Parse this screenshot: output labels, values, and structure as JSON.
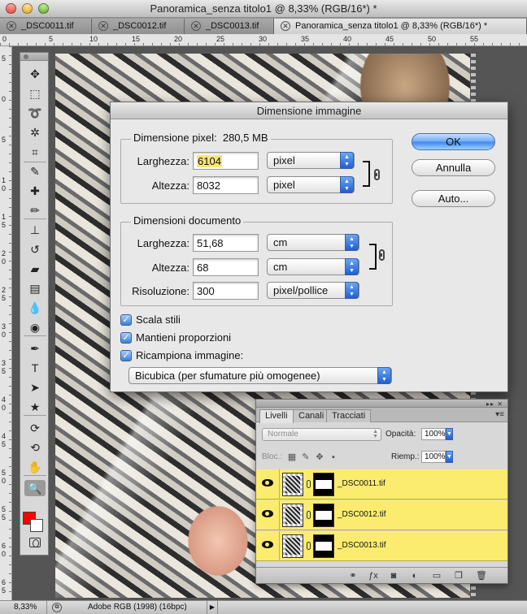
{
  "window": {
    "title": "Panoramica_senza titolo1 @ 8,33% (RGB/16*) *"
  },
  "tabs": [
    {
      "label": "_DSC0011.tif",
      "close_glyph": "✕"
    },
    {
      "label": "_DSC0012.tif",
      "close_glyph": "✕"
    },
    {
      "label": "_DSC0013.tif",
      "close_glyph": "✕"
    },
    {
      "label": "Panoramica_senza titolo1 @ 8,33% (RGB/16*) *",
      "close_glyph": "✕"
    }
  ],
  "ruler_top": [
    "0",
    "5",
    "10",
    "15",
    "20",
    "25",
    "30",
    "35",
    "40",
    "45",
    "50",
    "55"
  ],
  "ruler_left": [
    "5",
    "0",
    "5",
    "1 0",
    "1 5",
    "2 0",
    "2 5",
    "3 0",
    "3 5",
    "4 0",
    "4 5",
    "5 0",
    "5 5",
    "6 0",
    "6 5"
  ],
  "tools": [
    {
      "name": "move-tool-icon",
      "glyph": "✥"
    },
    {
      "name": "marquee-tool-icon",
      "glyph": "⬚"
    },
    {
      "name": "lasso-tool-icon",
      "glyph": "➰"
    },
    {
      "name": "magic-wand-tool-icon",
      "glyph": "✲"
    },
    {
      "name": "crop-tool-icon",
      "glyph": "⌗"
    },
    {
      "name": "eyedropper-tool-icon",
      "glyph": "✎"
    },
    {
      "name": "healing-brush-tool-icon",
      "glyph": "✚"
    },
    {
      "name": "brush-tool-icon",
      "glyph": "✏"
    },
    {
      "name": "clone-stamp-tool-icon",
      "glyph": "⊥"
    },
    {
      "name": "history-brush-tool-icon",
      "glyph": "↺"
    },
    {
      "name": "eraser-tool-icon",
      "glyph": "▰"
    },
    {
      "name": "gradient-tool-icon",
      "glyph": "▤"
    },
    {
      "name": "blur-tool-icon",
      "glyph": "💧"
    },
    {
      "name": "dodge-tool-icon",
      "glyph": "◉"
    },
    {
      "name": "pen-tool-icon",
      "glyph": "✒"
    },
    {
      "name": "type-tool-icon",
      "glyph": "T"
    },
    {
      "name": "path-selection-tool-icon",
      "glyph": "➤"
    },
    {
      "name": "shape-tool-icon",
      "glyph": "★"
    },
    {
      "name": "3d-rotate-tool-icon",
      "glyph": "⟳"
    },
    {
      "name": "3d-orbit-tool-icon",
      "glyph": "⟲"
    },
    {
      "name": "hand-tool-icon",
      "glyph": "✋"
    },
    {
      "name": "zoom-tool-icon",
      "glyph": "🔍"
    }
  ],
  "colors": {
    "foreground": "#ff0000",
    "background": "#ffffff",
    "layer_highlight": "#fbec6f"
  },
  "dialog": {
    "title": "Dimensione immagine",
    "pixel_group": {
      "legend": "Dimensione pixel:",
      "size": "280,5 MB",
      "width_label": "Larghezza:",
      "width_value": "6104",
      "width_unit": "pixel",
      "height_label": "Altezza:",
      "height_value": "8032",
      "height_unit": "pixel"
    },
    "document_group": {
      "legend": "Dimensioni documento",
      "width_label": "Larghezza:",
      "width_value": "51,68",
      "width_unit": "cm",
      "height_label": "Altezza:",
      "height_value": "68",
      "height_unit": "cm",
      "resolution_label": "Risoluzione:",
      "resolution_value": "300",
      "resolution_unit": "pixel/pollice"
    },
    "options": {
      "scale_styles": "Scala stili",
      "constrain": "Mantieni proporzioni",
      "resample": "Ricampiona immagine:",
      "check_glyph": "✓"
    },
    "resample_method": "Bicubica (per sfumature più omogenee)",
    "buttons": {
      "ok": "OK",
      "cancel": "Annulla",
      "auto": "Auto..."
    }
  },
  "layers_panel": {
    "tabs": [
      "Livelli",
      "Canali",
      "Tracciati"
    ],
    "menu_glyph": "▾≡",
    "blend_mode": "Normale",
    "opacity_label": "Opacità:",
    "opacity_value": "100%",
    "lock_label": "Bloc.:",
    "fill_label": "Riemp.:",
    "fill_value": "100%",
    "layers": [
      {
        "name": "_DSC0011.tif"
      },
      {
        "name": "_DSC0012.tif"
      },
      {
        "name": "_DSC0013.tif"
      }
    ]
  },
  "status": {
    "zoom": "8,33%",
    "profile": "Adobe RGB (1998) (16bpc)"
  }
}
